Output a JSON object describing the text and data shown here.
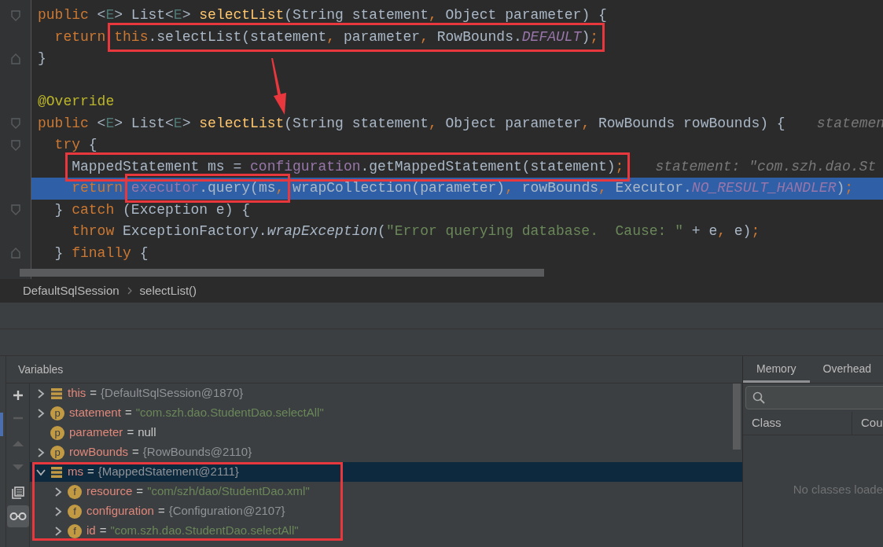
{
  "editor": {
    "lines": [
      {
        "kind": "code",
        "fold": {
          "kind": "start"
        },
        "tokens": [
          {
            "kind": "kw",
            "text": "public"
          },
          {
            "kind": "plain",
            "text": " <"
          },
          {
            "kind": "tparam",
            "text": "E"
          },
          {
            "kind": "plain",
            "text": "> List<"
          },
          {
            "kind": "tparam",
            "text": "E"
          },
          {
            "kind": "plain",
            "text": "> "
          },
          {
            "kind": "decl",
            "text": "selectList"
          },
          {
            "kind": "plain",
            "text": "(String statement"
          },
          {
            "kind": "punct",
            "text": ","
          },
          {
            "kind": "plain",
            "text": " Object parameter) {"
          }
        ]
      },
      {
        "kind": "code",
        "tokens": [
          {
            "kind": "kw",
            "text": "  return "
          },
          {
            "kind": "box",
            "tokens": [
              {
                "kind": "kw",
                "text": "this"
              },
              {
                "kind": "plain",
                "text": ".selectList(statement"
              },
              {
                "kind": "punct",
                "text": ","
              },
              {
                "kind": "plain",
                "text": " parameter"
              },
              {
                "kind": "punct",
                "text": ","
              },
              {
                "kind": "plain",
                "text": " RowBounds."
              },
              {
                "kind": "const",
                "text": "DEFAULT"
              },
              {
                "kind": "plain",
                "text": ")"
              },
              {
                "kind": "punct",
                "text": ";"
              }
            ]
          }
        ]
      },
      {
        "kind": "code",
        "fold": {
          "kind": "end"
        },
        "tokens": [
          {
            "kind": "plain",
            "text": "}"
          }
        ]
      },
      {
        "kind": "blank"
      },
      {
        "kind": "code",
        "tokens": [
          {
            "kind": "ann",
            "text": "@Override"
          }
        ]
      },
      {
        "kind": "code",
        "fold": {
          "kind": "start"
        },
        "hint": "statemen",
        "tokens": [
          {
            "kind": "kw",
            "text": "public"
          },
          {
            "kind": "plain",
            "text": " <"
          },
          {
            "kind": "tparam",
            "text": "E"
          },
          {
            "kind": "plain",
            "text": "> List<"
          },
          {
            "kind": "tparam",
            "text": "E"
          },
          {
            "kind": "plain",
            "text": "> "
          },
          {
            "kind": "decl",
            "text": "selectList"
          },
          {
            "kind": "plain",
            "text": "(String statement"
          },
          {
            "kind": "punct",
            "text": ","
          },
          {
            "kind": "plain",
            "text": " Object parameter"
          },
          {
            "kind": "punct",
            "text": ","
          },
          {
            "kind": "plain",
            "text": " RowBounds rowBounds) {"
          }
        ]
      },
      {
        "kind": "code",
        "fold": {
          "kind": "start"
        },
        "tokens": [
          {
            "kind": "kw",
            "text": "  try"
          },
          {
            "kind": "plain",
            "text": " {"
          }
        ]
      },
      {
        "kind": "code",
        "hint": "statement: \"com.szh.dao.St",
        "tokens": [
          {
            "kind": "box",
            "tokens": [
              {
                "kind": "plain",
                "text": "    MappedStatement ms = "
              },
              {
                "kind": "field",
                "text": "configuration"
              },
              {
                "kind": "plain",
                "text": ".getMappedStatement(statement)"
              },
              {
                "kind": "punct",
                "text": ";"
              }
            ]
          }
        ]
      },
      {
        "kind": "code",
        "current": true,
        "tokens": [
          {
            "kind": "kw",
            "text": "    return "
          },
          {
            "kind": "box",
            "tokens": [
              {
                "kind": "field",
                "text": "executor"
              },
              {
                "kind": "plain",
                "text": ".query(ms"
              },
              {
                "kind": "punct",
                "text": ","
              }
            ]
          },
          {
            "kind": "plain",
            "text": " wrapCollection(parameter)"
          },
          {
            "kind": "punct",
            "text": ","
          },
          {
            "kind": "plain",
            "text": " rowBounds"
          },
          {
            "kind": "punct",
            "text": ","
          },
          {
            "kind": "plain",
            "text": " Executor."
          },
          {
            "kind": "const",
            "text": "NO_RESULT_HANDLER"
          },
          {
            "kind": "plain",
            "text": ")"
          },
          {
            "kind": "punct",
            "text": ";"
          }
        ]
      },
      {
        "kind": "code",
        "fold": {
          "kind": "start"
        },
        "tokens": [
          {
            "kind": "plain",
            "text": "  } "
          },
          {
            "kind": "kw",
            "text": "catch"
          },
          {
            "kind": "plain",
            "text": " (Exception e) {"
          }
        ]
      },
      {
        "kind": "code",
        "tokens": [
          {
            "kind": "kw",
            "text": "    throw"
          },
          {
            "kind": "plain",
            "text": " ExceptionFactory."
          },
          {
            "kind": "static",
            "text": "wrapException"
          },
          {
            "kind": "plain",
            "text": "("
          },
          {
            "kind": "str",
            "text": "\"Error querying database.  Cause: \""
          },
          {
            "kind": "plain",
            "text": " + e"
          },
          {
            "kind": "punct",
            "text": ","
          },
          {
            "kind": "plain",
            "text": " e)"
          },
          {
            "kind": "punct",
            "text": ";"
          }
        ]
      },
      {
        "kind": "code",
        "fold": {
          "kind": "end"
        },
        "tokens": [
          {
            "kind": "plain",
            "text": "  } "
          },
          {
            "kind": "kw",
            "text": "finally"
          },
          {
            "kind": "plain",
            "text": " {"
          }
        ]
      }
    ]
  },
  "breadcrumbs": [
    "DefaultSqlSession",
    "selectList()"
  ],
  "variables": {
    "title": "Variables",
    "items": [
      {
        "kind": "object",
        "name": "this",
        "operator": "=",
        "value": {
          "kind": "object",
          "text": "{DefaultSqlSession@1870}"
        },
        "expanded": false,
        "selected": false
      },
      {
        "kind": "param",
        "badge": "p",
        "name": "statement",
        "operator": "=",
        "value": {
          "kind": "string",
          "text": "\"com.szh.dao.StudentDao.selectAll\""
        },
        "expanded": false,
        "selected": false
      },
      {
        "kind": "param",
        "badge": "p",
        "name": "parameter",
        "operator": "=",
        "value": {
          "kind": "null",
          "text": "null"
        },
        "selected": false
      },
      {
        "kind": "param",
        "badge": "p",
        "name": "rowBounds",
        "operator": "=",
        "value": {
          "kind": "object",
          "text": "{RowBounds@2110}"
        },
        "expanded": false,
        "selected": false
      },
      {
        "kind": "object",
        "name": "ms",
        "operator": "=",
        "value": {
          "kind": "object",
          "text": "{MappedStatement@2111}"
        },
        "expanded": true,
        "selected": true,
        "boxed": true,
        "children": [
          {
            "kind": "field",
            "badge": "f",
            "name": "resource",
            "operator": "=",
            "value": {
              "kind": "string",
              "text": "\"com/szh/dao/StudentDao.xml\""
            },
            "expanded": false,
            "selected": false
          },
          {
            "kind": "field",
            "badge": "f",
            "name": "configuration",
            "operator": "=",
            "value": {
              "kind": "object",
              "text": "{Configuration@2107}"
            },
            "expanded": false,
            "selected": false
          },
          {
            "kind": "field",
            "badge": "f",
            "name": "id",
            "operator": "=",
            "value": {
              "kind": "string",
              "text": "\"com.szh.dao.StudentDao.selectAll\""
            },
            "expanded": false,
            "selected": false
          }
        ]
      }
    ]
  },
  "memory": {
    "tabs": [
      {
        "label": "Memory",
        "selected": true
      },
      {
        "label": "Overhead",
        "selected": false
      }
    ],
    "columns": [
      "Class",
      "Cou"
    ],
    "empty_text": "No classes loade"
  }
}
